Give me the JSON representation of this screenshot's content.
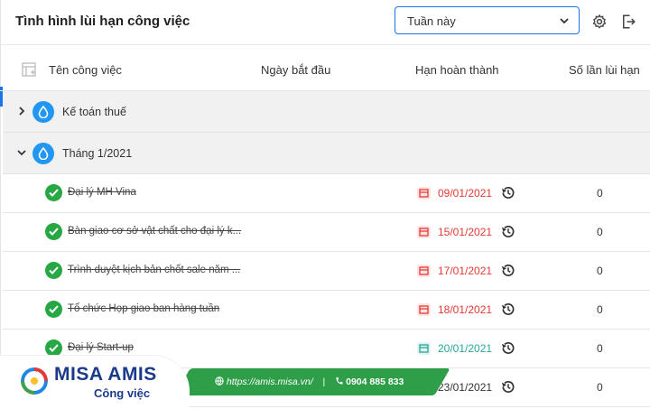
{
  "header": {
    "title": "Tình hình lùi hạn công việc",
    "period_value": "Tuần này"
  },
  "columns": {
    "name": "Tên công việc",
    "start": "Ngày bắt đầu",
    "due": "Hạn hoàn thành",
    "count": "Số lần lùi hạn"
  },
  "groups": [
    {
      "label": "Kế toán thuế",
      "expanded": false
    },
    {
      "label": "Tháng 1/2021",
      "expanded": true
    }
  ],
  "tasks": [
    {
      "name": "Đại lý MH Vina",
      "due": "09/01/2021",
      "status": "overdue",
      "count": "0"
    },
    {
      "name": "Bàn giao cơ sở vật chất cho đại lý k...",
      "due": "15/01/2021",
      "status": "overdue",
      "count": "0"
    },
    {
      "name": "Trình duyệt kịch bản chốt sale năm ...",
      "due": "17/01/2021",
      "status": "overdue",
      "count": "0"
    },
    {
      "name": "Tổ chức Họp giao ban hàng tuần",
      "due": "18/01/2021",
      "status": "overdue",
      "count": "0"
    },
    {
      "name": "Đại lý Start-up",
      "due": "20/01/2021",
      "status": "ontime",
      "count": "0"
    },
    {
      "name": "",
      "due": "23/01/2021",
      "status": "normal",
      "count": "0"
    }
  ],
  "branding": {
    "name": "MISA AMIS",
    "sub": "Công việc",
    "url": "https://amis.misa.vn/",
    "phone": "0904 885 833"
  },
  "colors": {
    "accent": "#1a73e8",
    "done_green": "#27a844",
    "overdue_red": "#e53935",
    "ontime_teal": "#26a69a",
    "group_icon_blue": "#2196f3"
  },
  "icons": [
    "chevron-down-icon",
    "settings-icon",
    "logout-icon",
    "column-layout-icon",
    "chevron-right-icon",
    "water-drop-icon",
    "check-circle-icon",
    "calendar-icon",
    "history-icon",
    "globe-icon",
    "phone-icon"
  ]
}
